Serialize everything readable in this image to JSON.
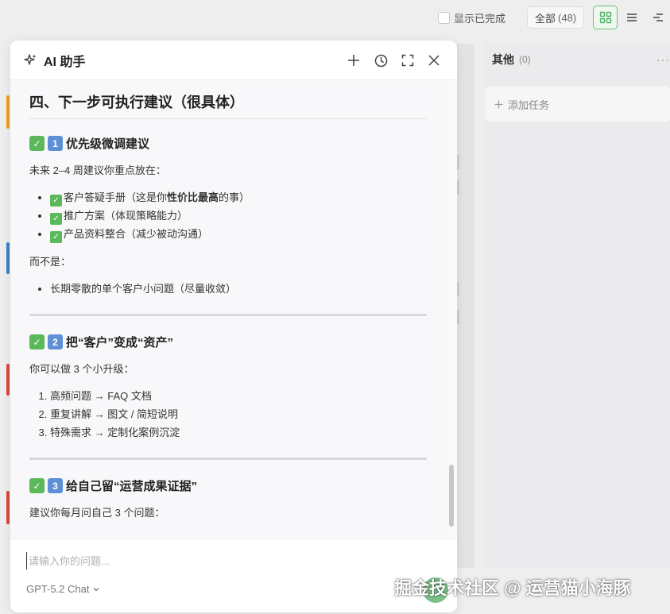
{
  "topbar": {
    "show_completed_label": "显示已完成",
    "filter_all_label": "全部",
    "filter_all_count": "(48)"
  },
  "column_other": {
    "title": "其他",
    "count": "(0)",
    "more": "···",
    "add_task_label": "添加任务"
  },
  "ai_panel": {
    "title": "AI 助手",
    "section_title": "四、下一步可执行建议（很具体）",
    "block1": {
      "heading": "优先级微调建议",
      "number": "1",
      "intro": "未来 2–4 周建议你重点放在：",
      "item1_pre": "客户答疑手册（这是你",
      "item1_bold": "性价比最高",
      "item1_post": "的事）",
      "item2": "推广方案（体现策略能力）",
      "item3": "产品资料整合（减少被动沟通）",
      "instead_label": "而不是：",
      "instead_item": "长期零散的单个客户小问题（尽量收敛）"
    },
    "block2": {
      "heading": "把“客户”变成“资产”",
      "number": "2",
      "intro": "你可以做 3 个小升级：",
      "items": [
        "高频问题 → FAQ 文档",
        "重复讲解 → 图文 / 简短说明",
        "特殊需求 → 定制化案例沉淀"
      ]
    },
    "block3": {
      "heading": "给自己留“运营成果证据”",
      "number": "3",
      "intro": "建议你每月问自己 3 个问题："
    },
    "input_placeholder": "请输入你的问题...",
    "model_label": "GPT-5.2 Chat"
  },
  "watermark": "掘金技术社区 @ 运营猫小海豚",
  "colors": {
    "accent_green": "#5bb85b",
    "side_bar_orange": "#f0a020",
    "side_bar_blue": "#3b82c4",
    "side_bar_red": "#d94a3a"
  }
}
